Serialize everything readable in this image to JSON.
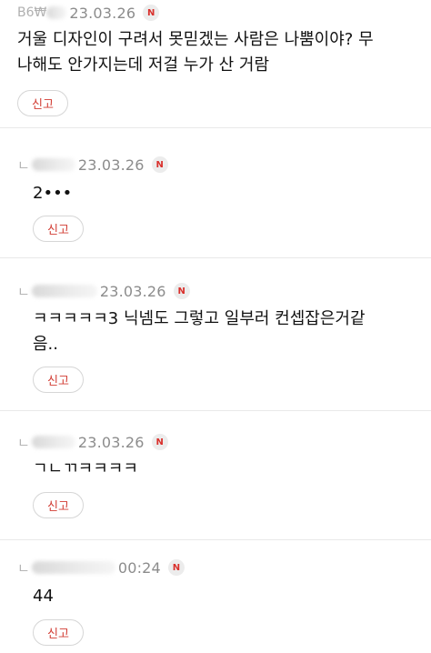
{
  "comments": [
    {
      "author_partial": "B6₩",
      "reply_mark": "",
      "date": "23.03.26",
      "new_badge": "N",
      "text": "거울 디자인이 구려서 못믿겠는 사람은 나뿜이야? 무\n나해도 안가지는데 저걸 누가 산 거람",
      "report_label": "신고"
    },
    {
      "author_partial": "",
      "reply_mark": "ㄴ",
      "date": "23.03.26",
      "new_badge": "N",
      "text": "2•••",
      "report_label": "신고"
    },
    {
      "author_partial": "",
      "reply_mark": "ㄴ",
      "date": "23.03.26",
      "new_badge": "N",
      "text": "ㅋㅋㅋㅋㅋ3 닉넴도 그렇고 일부러 컨셉잡은거같\n음..",
      "report_label": "신고"
    },
    {
      "author_partial": "",
      "reply_mark": "ㄴ",
      "date": "23.03.26",
      "new_badge": "N",
      "text": "ㄱㄴㄲㅋㅋㅋㅋ",
      "report_label": "신고"
    },
    {
      "author_partial": "",
      "reply_mark": "ㄴ",
      "date": "00:24",
      "new_badge": "N",
      "text": "44",
      "report_label": "신고"
    }
  ],
  "colors": {
    "report_text": "#d23c33",
    "new_badge_text": "#d9302c",
    "divider": "#e9e9e9"
  }
}
